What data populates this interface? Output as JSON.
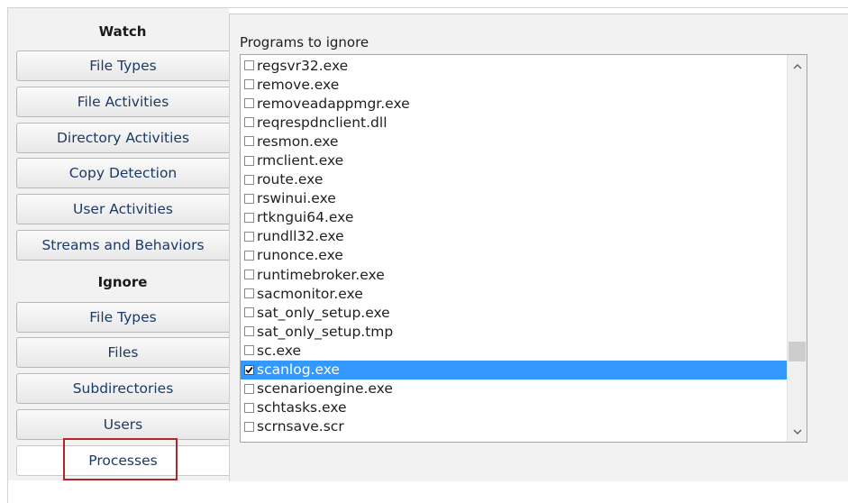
{
  "sidebar": {
    "watch_title": "Watch",
    "watch_items": [
      {
        "label": "File Types"
      },
      {
        "label": "File Activities"
      },
      {
        "label": "Directory Activities"
      },
      {
        "label": "Copy Detection"
      },
      {
        "label": "User Activities"
      },
      {
        "label": "Streams and Behaviors"
      }
    ],
    "ignore_title": "Ignore",
    "ignore_items": [
      {
        "label": "File Types"
      },
      {
        "label": "Files"
      },
      {
        "label": "Subdirectories"
      },
      {
        "label": "Users"
      },
      {
        "label": "Processes",
        "selected": true
      }
    ]
  },
  "main": {
    "label": "Programs to ignore",
    "programs": [
      {
        "name": "regsvr32.exe",
        "checked": false
      },
      {
        "name": "remove.exe",
        "checked": false
      },
      {
        "name": "removeadappmgr.exe",
        "checked": false
      },
      {
        "name": "reqrespdnclient.dll",
        "checked": false
      },
      {
        "name": "resmon.exe",
        "checked": false
      },
      {
        "name": "rmclient.exe",
        "checked": false
      },
      {
        "name": "route.exe",
        "checked": false
      },
      {
        "name": "rswinui.exe",
        "checked": false
      },
      {
        "name": "rtkngui64.exe",
        "checked": false
      },
      {
        "name": "rundll32.exe",
        "checked": false
      },
      {
        "name": "runonce.exe",
        "checked": false
      },
      {
        "name": "runtimebroker.exe",
        "checked": false
      },
      {
        "name": "sacmonitor.exe",
        "checked": false
      },
      {
        "name": "sat_only_setup.exe",
        "checked": false
      },
      {
        "name": "sat_only_setup.tmp",
        "checked": false
      },
      {
        "name": "sc.exe",
        "checked": false
      },
      {
        "name": "scanlog.exe",
        "checked": true,
        "selected": true
      },
      {
        "name": "scenarioengine.exe",
        "checked": false
      },
      {
        "name": "schtasks.exe",
        "checked": false
      },
      {
        "name": "scrnsave.scr",
        "checked": false
      }
    ]
  },
  "icons": {
    "scroll_up": "chevron-up-icon",
    "scroll_down": "chevron-down-icon",
    "check": "checkmark-icon"
  },
  "colors": {
    "selection": "#3399ff",
    "active_outline": "#b2262b",
    "nav_text": "#1d3966"
  }
}
